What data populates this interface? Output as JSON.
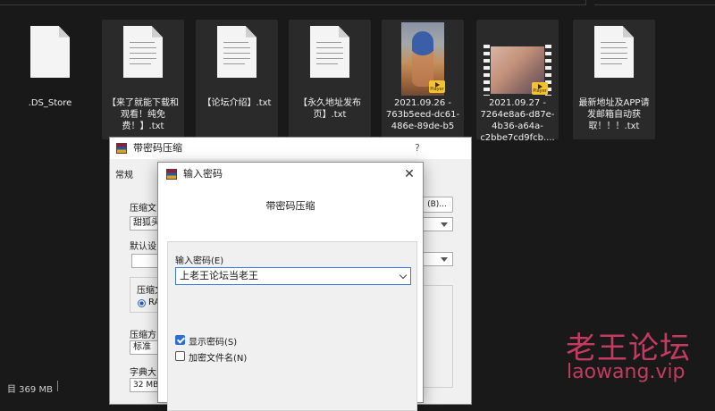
{
  "files": [
    {
      "name": ".DS_Store",
      "type": "file",
      "selected": false
    },
    {
      "name": "【来了就能下载和观看！纯免费！】.txt",
      "type": "text",
      "selected": true
    },
    {
      "name": "【论坛介绍】.txt",
      "type": "text",
      "selected": true
    },
    {
      "name": "【永久地址发布页】.txt",
      "type": "text",
      "selected": true
    },
    {
      "name": "2021.09.26 - 763b5eed-dc61-486e-89de-b5",
      "type": "video",
      "selected": true,
      "badge": "Player"
    },
    {
      "name": "2021.09.27 - 7264e8a6-d87e-4b36-a64a-c2bbe7cd9fcb....",
      "type": "video",
      "selected": true,
      "badge": "Player"
    },
    {
      "name": "最新地址及APP请发邮箱自动获取！！！.txt",
      "type": "text",
      "selected": true
    }
  ],
  "statusbar": {
    "text": "目 369 MB"
  },
  "archive_dialog": {
    "title": "带密码压缩",
    "help": "?",
    "tab": "常规",
    "label_archive": "压缩文",
    "archive_value": "甜狐头",
    "browse_label": "(B)...",
    "label_default": "默认设",
    "label_format": "压缩文",
    "format_radio": "RA",
    "label_method": "压缩方",
    "method_value": "标准",
    "label_dict": "字典大",
    "dict_value": "32 MB"
  },
  "password_dialog": {
    "title": "输入密码",
    "heading": "带密码压缩",
    "field_label": "输入密码(E)",
    "password_value": "上老王论坛当老王",
    "show_password_label": "显示密码(S)",
    "show_password_checked": true,
    "encrypt_names_label": "加密文件名(N)",
    "encrypt_names_checked": false
  },
  "watermark": {
    "cn": "老王论坛",
    "en": "laowang.vip"
  },
  "colors": {
    "accent": "#2b6fd6",
    "watermark": "#c43a62",
    "background": "#191919"
  }
}
